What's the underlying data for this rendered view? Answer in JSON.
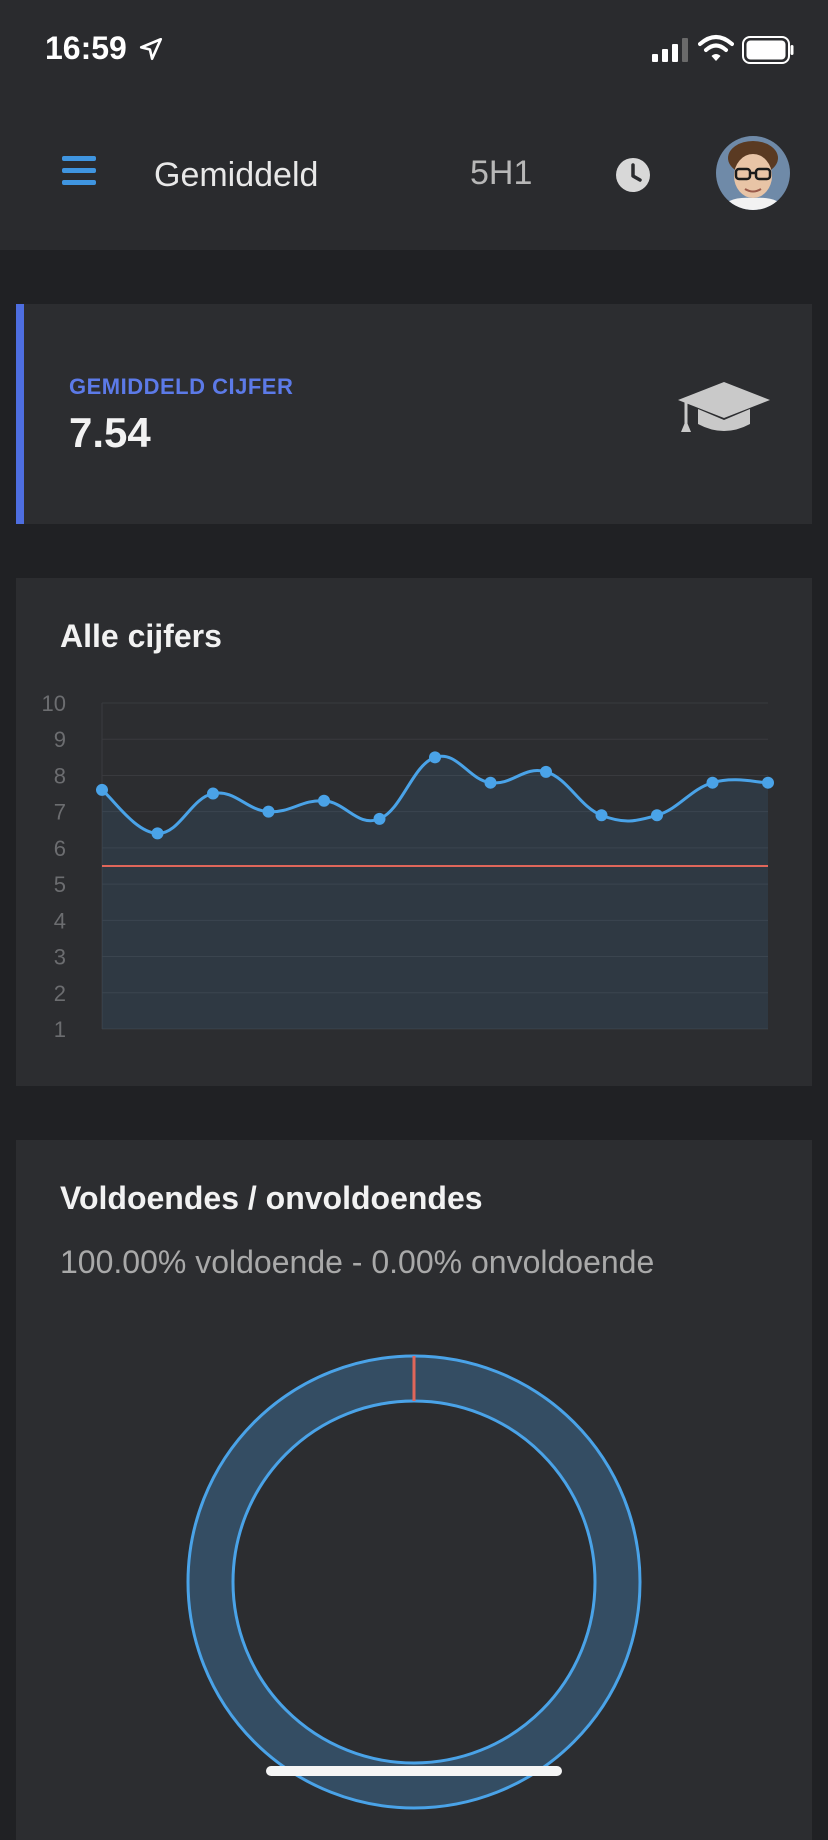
{
  "status_bar": {
    "time": "16:59",
    "icons": [
      "location-arrow-icon",
      "signal-icon",
      "wifi-icon",
      "battery-icon"
    ]
  },
  "header": {
    "menu_icon": "hamburger-icon",
    "title": "Gemiddeld",
    "class_name": "5H1",
    "clock_icon": "clock-icon"
  },
  "average_card": {
    "label": "GEMIDDELD CIJFER",
    "value": "7.54",
    "icon": "graduation-cap-icon",
    "accent": "#4e6ee0"
  },
  "chart_data": [
    {
      "type": "line",
      "title": "Alle cijfers",
      "xlabel": "",
      "ylabel": "",
      "ylim": [
        1,
        10
      ],
      "yticks": [
        "10",
        "9",
        "8",
        "7",
        "6",
        "5",
        "4",
        "3",
        "2",
        "1"
      ],
      "grid": true,
      "legend": "none",
      "x": [
        1,
        2,
        3,
        4,
        5,
        6,
        7,
        8,
        9,
        10,
        11,
        12,
        13
      ],
      "series": [
        {
          "values": [
            7.6,
            6.4,
            7.5,
            7.0,
            7.3,
            6.8,
            8.5,
            7.8,
            8.1,
            6.9,
            6.9,
            7.8,
            7.8
          ],
          "color": "#4aa3e8"
        }
      ],
      "reference_line": {
        "value": 5.5,
        "color": "#e0665a"
      }
    },
    {
      "type": "pie",
      "title": "Voldoendes / onvoldoendes",
      "subtitle": "100.00% voldoende - 0.00% onvoldoende",
      "categories": [
        "voldoende",
        "onvoldoende"
      ],
      "values": [
        100.0,
        0.0
      ],
      "colors": [
        "#4aa3e8",
        "#e0665a"
      ]
    }
  ]
}
